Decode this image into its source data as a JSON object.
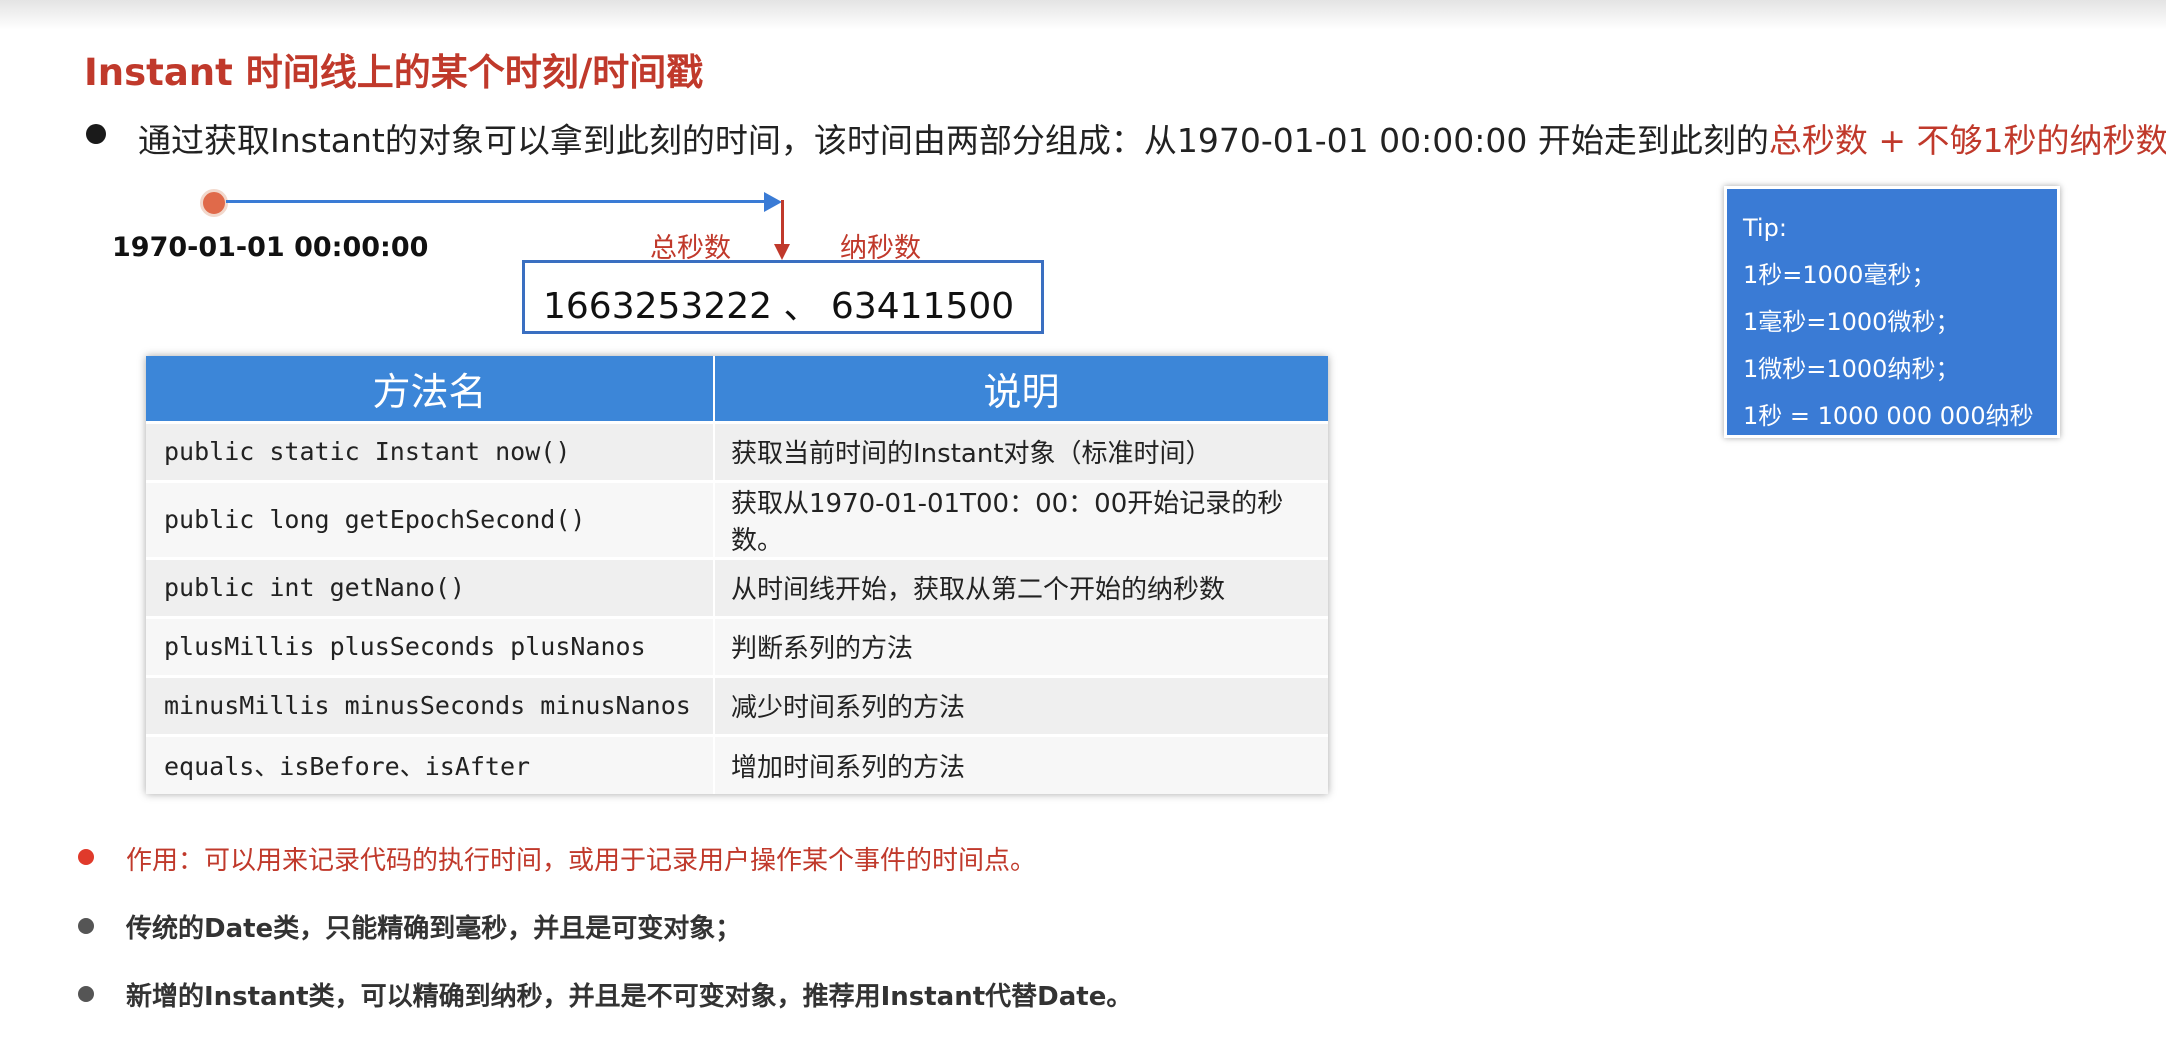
{
  "title": "Instant 时间线上的某个时刻/时间戳",
  "main_bullet": {
    "text": "通过获取Instant的对象可以拿到此刻的时间，该时间由两部分组成：从1970-01-01 00:00:00 开始走到此刻的",
    "highlight": "总秒数 + 不够1秒的纳秒数"
  },
  "timeline": {
    "epoch_label": "1970-01-01 00:00:00",
    "seconds_label": "总秒数",
    "nanos_label": "纳秒数",
    "value": "1663253222 、  63411500"
  },
  "table": {
    "headers": [
      "方法名",
      "说明"
    ],
    "rows": [
      {
        "method": "public static Instant now()",
        "desc": "获取当前时间的Instant对象（标准时间）"
      },
      {
        "method": "public long getEpochSecond()",
        "desc": "获取从1970-01-01T00：00：00开始记录的秒数。"
      },
      {
        "method": "public int getNano()",
        "desc": "从时间线开始，获取从第二个开始的纳秒数"
      },
      {
        "method": "plusMillis plusSeconds plusNanos",
        "desc": "判断系列的方法"
      },
      {
        "method": "minusMillis minusSeconds minusNanos",
        "desc": "减少时间系列的方法"
      },
      {
        "method": "equals、isBefore、isAfter",
        "desc": "增加时间系列的方法"
      }
    ]
  },
  "tip": {
    "lines": [
      "Tip:",
      "1秒=1000毫秒；",
      "1毫秒=1000微秒；",
      "1微秒=1000纳秒；",
      "1秒 = 1000 000 000纳秒"
    ]
  },
  "bullets": [
    "作用：可以用来记录代码的执行时间，或用于记录用户操作某个事件的时间点。",
    "传统的Date类，只能精确到毫秒，并且是可变对象；",
    "新增的Instant类，可以精确到纳秒，并且是不可变对象，推荐用Instant代替Date。"
  ],
  "colors": {
    "accent_red": "#c0392b",
    "table_header_blue": "#3c86d8",
    "tip_blue": "#3a7bd5",
    "value_box_border": "#3a6fc1"
  }
}
